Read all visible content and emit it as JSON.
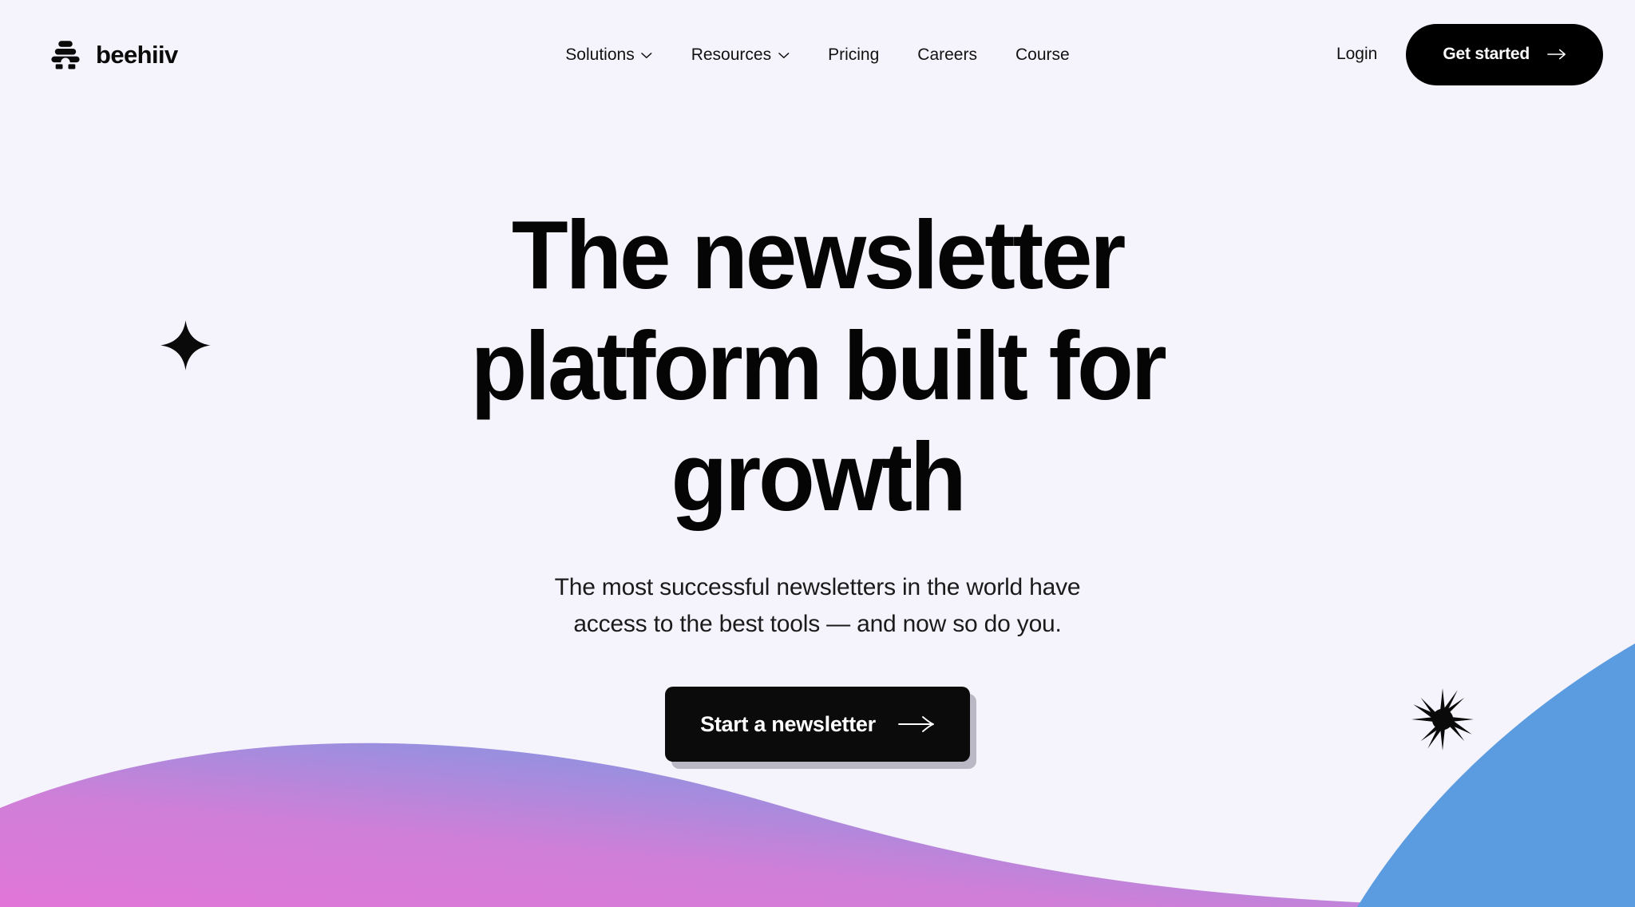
{
  "theme": {
    "background": "#f5f4fd",
    "text": "#121212",
    "accent_black": "#000000",
    "wave_pink": "#da7bd4",
    "wave_blue": "#5b9bdf",
    "shadow_gray": "#b9b8c4"
  },
  "header": {
    "brand": {
      "name": "beehiiv",
      "logo_icon": "beehive-icon"
    },
    "nav": [
      {
        "label": "Solutions",
        "has_dropdown": true,
        "icon": "chevron-down-icon"
      },
      {
        "label": "Resources",
        "has_dropdown": true,
        "icon": "chevron-down-icon"
      },
      {
        "label": "Pricing",
        "has_dropdown": false,
        "icon": ""
      },
      {
        "label": "Careers",
        "has_dropdown": false,
        "icon": ""
      },
      {
        "label": "Course",
        "has_dropdown": false,
        "icon": ""
      }
    ],
    "login_label": "Login",
    "cta": {
      "label": "Get started",
      "icon": "arrow-right-icon"
    }
  },
  "hero": {
    "title": "The newsletter platform built for growth",
    "subtitle": "The most successful newsletters in the world have access to the best tools — and now so do you.",
    "cta": {
      "label": "Start a newsletter",
      "icon": "arrow-right-icon"
    }
  },
  "decorations": [
    {
      "name": "four-point-star-icon",
      "position": "left-middle"
    },
    {
      "name": "starburst-icon",
      "position": "right-lower"
    },
    {
      "name": "gradient-wave-shape",
      "position": "bottom-left"
    },
    {
      "name": "blue-curve-shape",
      "position": "bottom-right"
    }
  ]
}
